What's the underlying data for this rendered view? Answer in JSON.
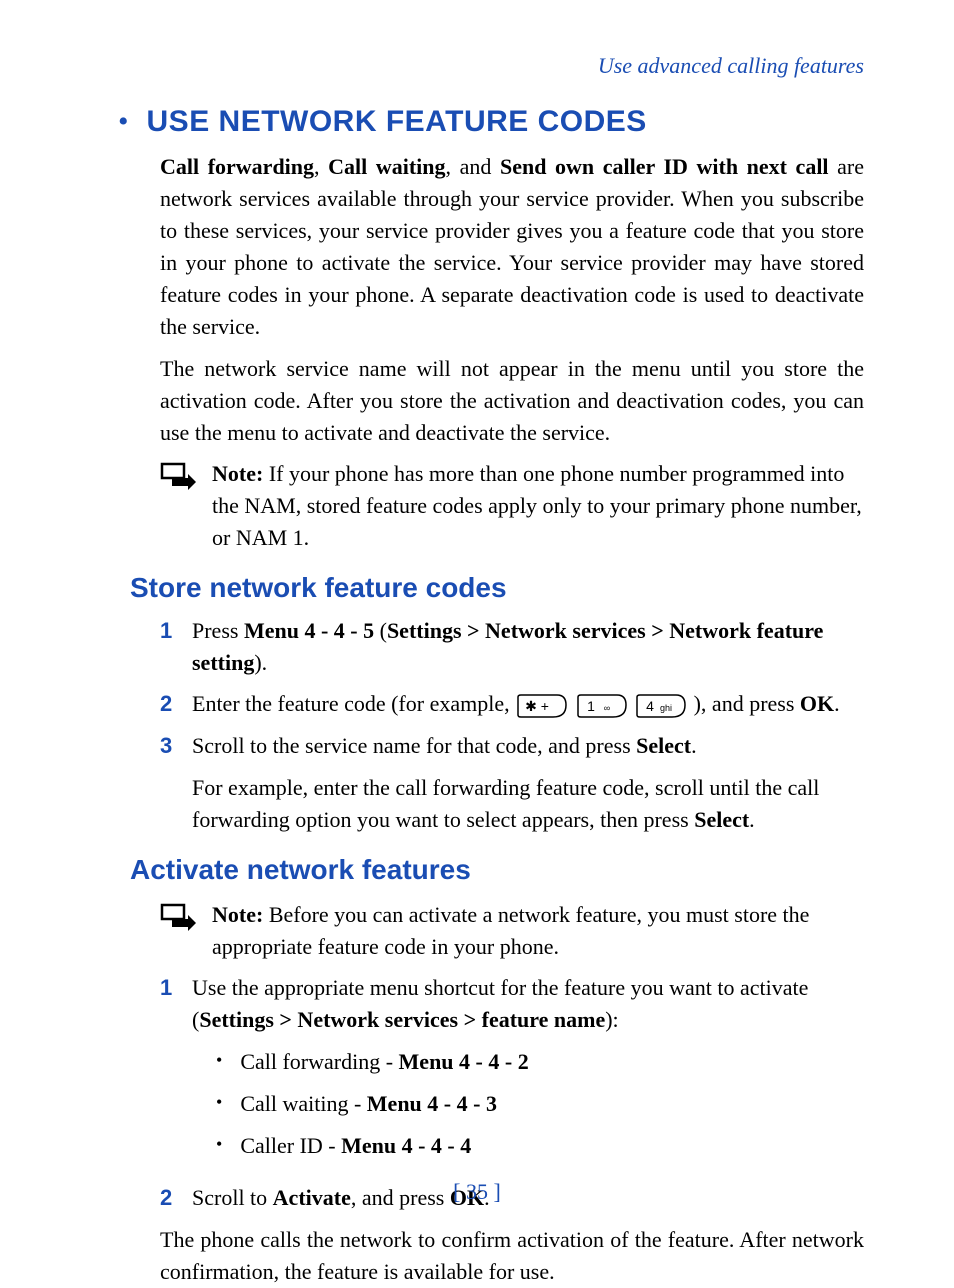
{
  "header_link": "Use advanced calling features",
  "title": "USE NETWORK FEATURE CODES",
  "intro1_parts": {
    "b1": "Call forwarding",
    "s1": ", ",
    "b2": "Call waiting",
    "s2": ", and ",
    "b3": "Send own caller ID with next call",
    "rest": " are network services available through your service provider. When you subscribe to these services, your service provider gives you a feature code that you store in your phone to activate the service. Your service provider may have stored feature codes in your phone. A separate deactivation code is used to deactivate the service."
  },
  "intro2": "The network service name will not appear in the menu until you store the activation code. After you store the activation and deactivation codes, you can use the menu to activate and deactivate the service.",
  "note1": {
    "label": "Note:",
    "text": " If your phone has more than one phone number programmed into the NAM, stored feature codes apply only to your primary phone number, or NAM 1."
  },
  "section_store": {
    "heading": "Store network feature codes",
    "items": [
      {
        "num": "1",
        "pre": "Press ",
        "b1": "Menu 4 - 4 - 5",
        "mid": " (",
        "b2": "Settings > Network services > Network feature setting",
        "post": ")."
      },
      {
        "num": "2",
        "pre": "Enter the feature code (for example, ",
        "keys": [
          "* +",
          "1",
          "4 ghi"
        ],
        "mid": "), and press ",
        "b1": "OK",
        "post": "."
      },
      {
        "num": "3",
        "pre": "Scroll to the service name for that code, and press ",
        "b1": "Select",
        "post": ".",
        "sub_pre": "For example, enter the call forwarding feature code, scroll until the call forwarding option you want to select appears, then press ",
        "sub_b": "Select",
        "sub_post": "."
      }
    ]
  },
  "section_activate": {
    "heading": "Activate network features",
    "note": {
      "label": "Note:",
      "text": " Before you can activate a network feature, you must store the appropriate feature code in your phone."
    },
    "items": [
      {
        "num": "1",
        "pre": "Use the appropriate menu shortcut for the feature you want to activate (",
        "b1": "Settings > Network services > feature name",
        "post": "):",
        "bullets": [
          {
            "pre": "Call forwarding - ",
            "b": "Menu 4 - 4 - 2"
          },
          {
            "pre": "Call waiting - ",
            "b": "Menu 4 - 4 - 3"
          },
          {
            "pre": "Caller ID - ",
            "b": "Menu 4 - 4 - 4"
          }
        ]
      },
      {
        "num": "2",
        "pre": "Scroll to ",
        "b1": "Activate",
        "mid": ", and press ",
        "b2": "OK",
        "post": "."
      }
    ],
    "outro": "The phone calls the network to confirm activation of the feature. After network confirmation, the feature is available for use."
  },
  "page_number": "[ 35 ]"
}
